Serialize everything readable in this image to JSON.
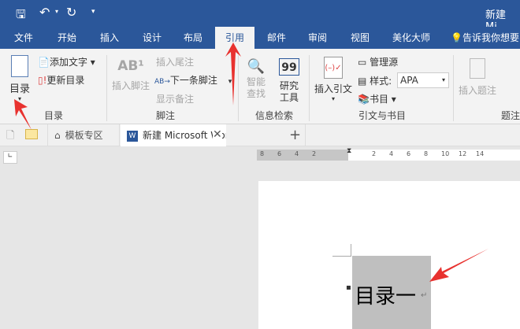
{
  "title": "新建 Mi",
  "qat": {
    "save": "save-icon",
    "undo": "undo-icon",
    "redo": "redo-icon",
    "customize": "▾"
  },
  "tabs": [
    "文件",
    "开始",
    "插入",
    "设计",
    "布局",
    "引用",
    "邮件",
    "审阅",
    "视图",
    "美化大师"
  ],
  "tell_me": "告诉我你想要",
  "ribbon": {
    "toc": {
      "big": "目录",
      "add_text": "添加文字",
      "update": "更新目录",
      "group": "目录"
    },
    "footnotes": {
      "insert": "插入脚注",
      "insert_endnote": "插入尾注",
      "next": "下一条脚注",
      "show": "显示备注",
      "group": "脚注"
    },
    "research": {
      "smart": "智能查找",
      "smart1": "智能",
      "smart2": "查找",
      "tool1": "研究",
      "tool2": "工具",
      "group": "信息检索"
    },
    "citations": {
      "insert": "插入引文",
      "manage": "管理源",
      "style_label": "样式:",
      "style_value": "APA",
      "bib": "书目",
      "group": "引文与书目"
    },
    "captions": {
      "insert": "插入题注",
      "group": "题注"
    }
  },
  "doctabs": {
    "templates": "模板专区",
    "doc": "新建 Microsoft Word 文档",
    "add": "+"
  },
  "ruler": {
    "left": [
      "8",
      "6",
      "4",
      "2"
    ],
    "right": [
      "2",
      "4",
      "6",
      "8",
      "10",
      "12",
      "14"
    ]
  },
  "document": {
    "text": "目录一"
  },
  "colors": {
    "accent": "#2b579a",
    "arrow": "#e8322f"
  }
}
